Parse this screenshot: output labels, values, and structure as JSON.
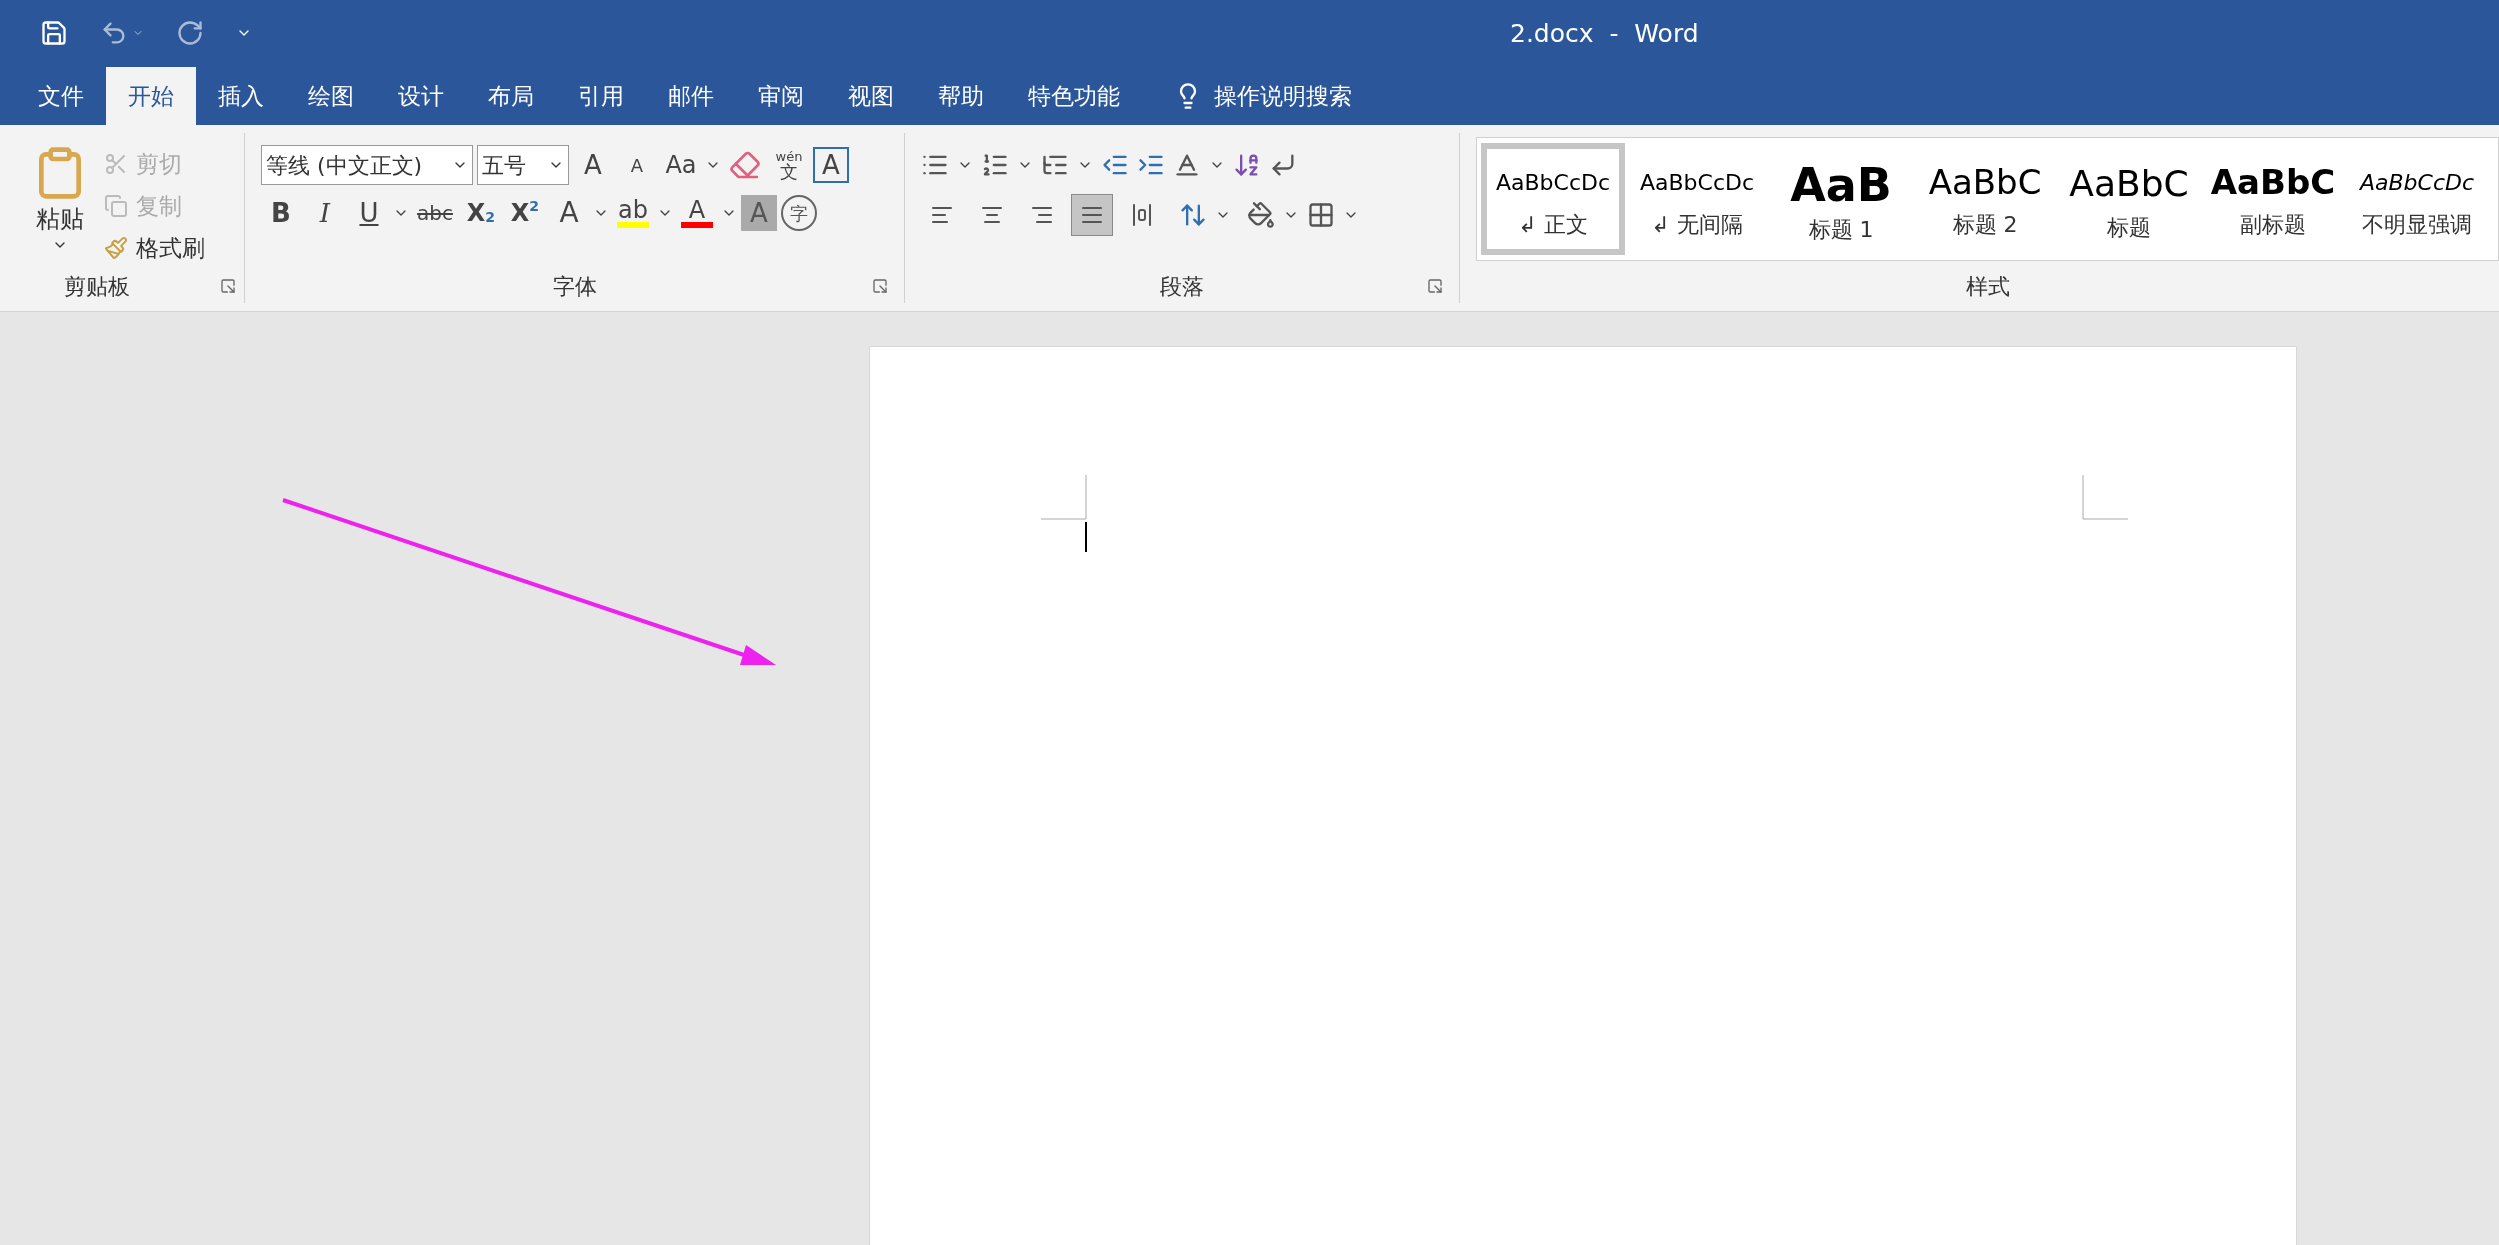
{
  "title_bar": {
    "title": "2.docx  -  Word"
  },
  "tabs": [
    {
      "label": "文件",
      "selected": false
    },
    {
      "label": "开始",
      "selected": true
    },
    {
      "label": "插入",
      "selected": false
    },
    {
      "label": "绘图",
      "selected": false
    },
    {
      "label": "设计",
      "selected": false
    },
    {
      "label": "布局",
      "selected": false
    },
    {
      "label": "引用",
      "selected": false
    },
    {
      "label": "邮件",
      "selected": false
    },
    {
      "label": "审阅",
      "selected": false
    },
    {
      "label": "视图",
      "selected": false
    },
    {
      "label": "帮助",
      "selected": false
    },
    {
      "label": "特色功能",
      "selected": false
    }
  ],
  "search": {
    "label": "操作说明搜索"
  },
  "clipboard": {
    "label": "剪贴板",
    "paste": "粘贴",
    "items": [
      {
        "kind": "cut",
        "label": "剪切",
        "disabled": true
      },
      {
        "kind": "copy",
        "label": "复制",
        "disabled": true
      },
      {
        "kind": "format_painter",
        "label": "格式刷",
        "disabled": false
      }
    ]
  },
  "font": {
    "label": "字体",
    "font_name": "等线 (中文正文)",
    "font_size": "五号",
    "row1": [
      {
        "kind": "grow",
        "text": "A"
      },
      {
        "kind": "shrink",
        "text": "A"
      },
      {
        "kind": "case",
        "text": "Aa"
      },
      {
        "kind": "clear"
      },
      {
        "kind": "phonetic",
        "text": "wén",
        "sub": "文"
      },
      {
        "kind": "border",
        "text": "A"
      }
    ],
    "row2": [
      {
        "kind": "bold",
        "text": "B"
      },
      {
        "kind": "italic",
        "text": "I"
      },
      {
        "kind": "underline",
        "text": "U"
      },
      {
        "kind": "strike",
        "text": "abc"
      },
      {
        "kind": "subscript",
        "text": "X",
        "sub": "2"
      },
      {
        "kind": "superscript",
        "text": "X",
        "sub": "2"
      },
      {
        "kind": "effects",
        "text": "A"
      },
      {
        "kind": "highlight",
        "text": "ab",
        "color": "#ffff00"
      },
      {
        "kind": "font_color",
        "text": "A",
        "color": "#ff0000"
      },
      {
        "kind": "shading",
        "text": "A"
      },
      {
        "kind": "enclose",
        "text": "字"
      }
    ]
  },
  "paragraph": {
    "label": "段落",
    "alignment": [
      {
        "kind": "left",
        "selected": false
      },
      {
        "kind": "center",
        "selected": false
      },
      {
        "kind": "right",
        "selected": false
      },
      {
        "kind": "justify",
        "selected": true
      },
      {
        "kind": "distributed",
        "selected": false
      }
    ]
  },
  "styles": {
    "label": "样式",
    "items": [
      {
        "kind": "normal",
        "preview": "AaBbCcDc",
        "label": "正文",
        "mark": "↲",
        "selected": true
      },
      {
        "kind": "normal",
        "preview": "AaBbCcDc",
        "label": "无间隔",
        "mark": "↲",
        "selected": false
      },
      {
        "kind": "heading1",
        "preview": "AaB",
        "label": "标题 1",
        "selected": false
      },
      {
        "kind": "heading2",
        "preview": "AaBbC",
        "label": "标题 2",
        "selected": false
      },
      {
        "kind": "title",
        "preview": "AaBbC",
        "label": "标题",
        "selected": false
      },
      {
        "kind": "subtitle",
        "preview": "AaBbC",
        "label": "副标题",
        "selected": false
      },
      {
        "kind": "emphasis",
        "preview": "AaBbCcDc",
        "label": "不明显强调",
        "selected": false
      }
    ]
  }
}
